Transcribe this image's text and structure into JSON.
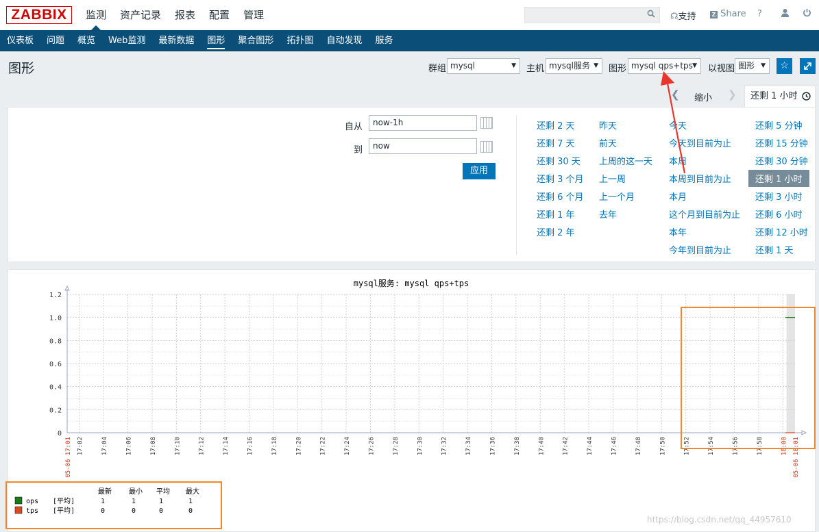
{
  "header": {
    "logo": "ZABBIX",
    "nav": [
      {
        "label": "监测",
        "active": true
      },
      {
        "label": "资产记录",
        "active": false
      },
      {
        "label": "报表",
        "active": false
      },
      {
        "label": "配置",
        "active": false
      },
      {
        "label": "管理",
        "active": false
      }
    ],
    "search": {
      "placeholder": "",
      "icon": "search-icon"
    },
    "support_label": "支持",
    "share_label": "Share",
    "help_icon": "?",
    "user_icon": "user-icon",
    "power_icon": "power-icon"
  },
  "subnav": [
    {
      "label": "仪表板",
      "active": false
    },
    {
      "label": "问题",
      "active": false
    },
    {
      "label": "概览",
      "active": false
    },
    {
      "label": "Web监测",
      "active": false
    },
    {
      "label": "最新数据",
      "active": false
    },
    {
      "label": "图形",
      "active": true
    },
    {
      "label": "聚合图形",
      "active": false
    },
    {
      "label": "拓扑图",
      "active": false
    },
    {
      "label": "自动发现",
      "active": false
    },
    {
      "label": "服务",
      "active": false
    }
  ],
  "page": {
    "title": "图形",
    "filters": {
      "group_label": "群组",
      "group_value": "mysql",
      "host_label": "主机",
      "host_value": "mysql服务",
      "graph_label": "图形",
      "graph_value": "mysql qps+tps",
      "view_label": "以视图",
      "view_value": "图形"
    }
  },
  "timebar": {
    "zoom_label": "缩小",
    "active_tab": "还剩 1 小时"
  },
  "timefilter": {
    "from_label": "自从",
    "from_value": "now-1h",
    "to_label": "到",
    "to_value": "now",
    "apply_label": "应用",
    "quick_ranges": [
      [
        "还剩 2 天",
        "还剩 7 天",
        "还剩 30 天",
        "还剩 3 个月",
        "还剩 6 个月",
        "还剩 1 年",
        "还剩 2 年"
      ],
      [
        "昨天",
        "前天",
        "上周的这一天",
        "上一周",
        "上一个月",
        "去年"
      ],
      [
        "今天",
        "今天到目前为止",
        "本周",
        "本周到目前为止",
        "本月",
        "这个月到目前为止",
        "本年",
        "今年到目前为止"
      ],
      [
        "还剩 5 分钟",
        "还剩 15 分钟",
        "还剩 30 分钟",
        "还剩 1 小时",
        "还剩 3 小时",
        "还剩 6 小时",
        "还剩 12 小时",
        "还剩 1 天"
      ]
    ],
    "selected": "还剩 1 小时"
  },
  "chart_data": {
    "type": "line",
    "title": "mysql服务: mysql qps+tps",
    "ylim": [
      0,
      1.2
    ],
    "yticks": [
      "0",
      "0.2",
      "0.4",
      "0.6",
      "0.8",
      "1.0",
      "1.2"
    ],
    "x_start_label": "05-06 17:01",
    "x_end_label": "05-06 18:01",
    "xticks": [
      "17:02",
      "17:04",
      "17:06",
      "17:08",
      "17:10",
      "17:12",
      "17:14",
      "17:16",
      "17:18",
      "17:20",
      "17:22",
      "17:24",
      "17:26",
      "17:28",
      "17:30",
      "17:32",
      "17:34",
      "17:36",
      "17:38",
      "17:40",
      "17:42",
      "17:44",
      "17:46",
      "17:48",
      "17:50",
      "17:52",
      "17:54",
      "17:56",
      "17:58",
      "18:00"
    ],
    "highlight_xticks": [
      "18:00"
    ],
    "series": [
      {
        "name": "ops",
        "color": "#1a7a1a",
        "points": [
          [
            59.2,
            1
          ],
          [
            60.0,
            1
          ]
        ]
      },
      {
        "name": "tps",
        "color": "#d94a1e",
        "points": [
          [
            59.2,
            0
          ],
          [
            60.0,
            0
          ]
        ]
      }
    ],
    "legend": {
      "headers": [
        "最新",
        "最小",
        "平均",
        "最大"
      ],
      "rows": [
        {
          "name": "ops",
          "func": "[平均]",
          "values": [
            "1",
            "1",
            "1",
            "1"
          ],
          "color": "#1a7a1a"
        },
        {
          "name": "tps",
          "func": "[平均]",
          "values": [
            "0",
            "0",
            "0",
            "0"
          ],
          "color": "#d94a1e"
        }
      ]
    }
  },
  "watermark": "https://blog.csdn.net/qq_44957610"
}
